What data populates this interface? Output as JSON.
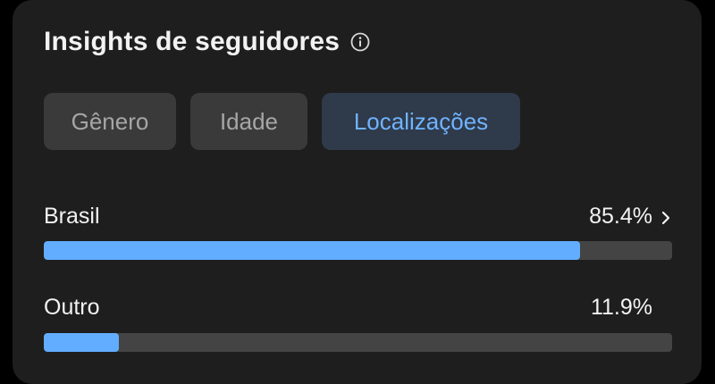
{
  "header": {
    "title": "Insights de seguidores",
    "info_icon": "info-icon"
  },
  "tabs": [
    {
      "label": "Gênero",
      "active": false
    },
    {
      "label": "Idade",
      "active": false
    },
    {
      "label": "Localizações",
      "active": true
    }
  ],
  "locations": [
    {
      "label": "Brasil",
      "value_text": "85.4%",
      "fraction": 0.854,
      "has_chevron": true
    },
    {
      "label": "Outro",
      "value_text": "11.9%",
      "fraction": 0.119,
      "has_chevron": false
    }
  ],
  "colors": {
    "card_background": "#1e1e1e",
    "active_tab_text": "#6fb3ff",
    "bar_fill": "#62adff",
    "bar_track": "#444444"
  }
}
